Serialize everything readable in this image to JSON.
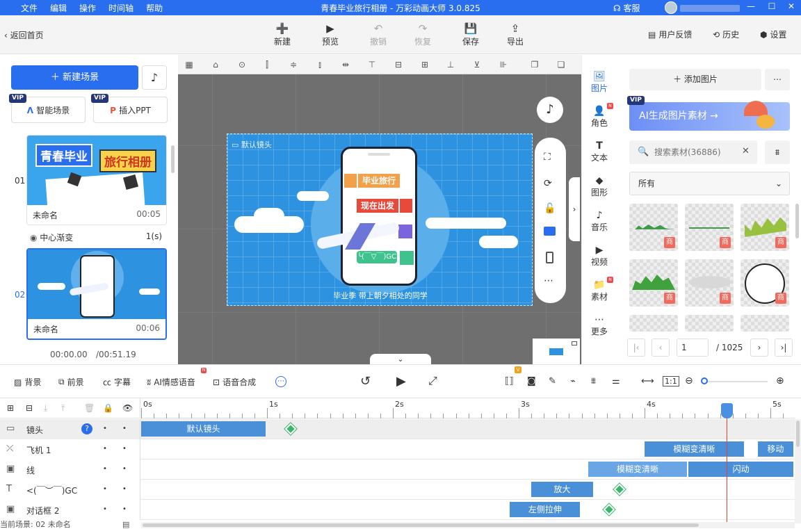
{
  "window": {
    "menu": [
      "文件",
      "编辑",
      "操作",
      "时间轴",
      "帮助"
    ],
    "title": "青春毕业旅行相册 - 万彩动画大师 3.0.825",
    "support": "客服",
    "controls": [
      "—",
      "☐",
      "✕"
    ]
  },
  "toolbar": {
    "back": "返回首页",
    "items": [
      {
        "label": "新建",
        "icon": "➕",
        "enabled": true
      },
      {
        "label": "预览",
        "icon": "▶",
        "enabled": true
      },
      {
        "label": "撤销",
        "icon": "↶",
        "enabled": false
      },
      {
        "label": "恢复",
        "icon": "↷",
        "enabled": false
      },
      {
        "label": "保存",
        "icon": "💾",
        "enabled": true
      },
      {
        "label": "导出",
        "icon": "⇪",
        "enabled": true
      }
    ],
    "feedback": "用户反馈",
    "history": "历史",
    "settings": "设置"
  },
  "left": {
    "new_scene": "新建场景",
    "vip_badge": "VIP",
    "smart_scene": "智能场景",
    "insert_ppt": "插入PPT",
    "scenes": [
      {
        "index": "01",
        "name": "未命名",
        "duration": "00:05",
        "banner_left": "青春毕业",
        "banner_right": "旅行相册"
      },
      {
        "index": "02",
        "name": "未命名",
        "duration": "00:06"
      }
    ],
    "transition": {
      "name": "中心渐变",
      "duration": "1(s)"
    },
    "time_current": "00:00.00",
    "time_total": "/00:51.19"
  },
  "stage": {
    "camera_label": "默认镜头",
    "badges": [
      "毕业旅行",
      "现在出发"
    ],
    "emoticon": "╰(￣▽￣)GC",
    "caption": "毕业季 带上朝夕相处的同学"
  },
  "right_nav": [
    {
      "label": "图片",
      "icon": "🖼",
      "active": true,
      "new": false
    },
    {
      "label": "角色",
      "icon": "👤",
      "active": false,
      "new": true
    },
    {
      "label": "文本",
      "icon": "T",
      "active": false,
      "new": false
    },
    {
      "label": "图形",
      "icon": "◆",
      "active": false,
      "new": false
    },
    {
      "label": "音乐",
      "icon": "♪",
      "active": false,
      "new": false
    },
    {
      "label": "视频",
      "icon": "▶",
      "active": false,
      "new": false
    },
    {
      "label": "素材",
      "icon": "📁",
      "active": false,
      "new": true
    },
    {
      "label": "更多",
      "icon": "⋯",
      "active": false,
      "new": false
    }
  ],
  "new_badge": "N",
  "right": {
    "add_image": "添加图片",
    "ai_banner": "AI生成图片素材",
    "search_placeholder": "搜索素材(36886)",
    "filter_value": "所有",
    "badge": "商",
    "page_current": "1",
    "page_total": "/ 1025"
  },
  "bottombar": {
    "tools": [
      "背景",
      "前景",
      "字幕",
      "AI情感语音",
      "语音合成"
    ]
  },
  "timeline": {
    "ticks": [
      "0s",
      "1s",
      "2s",
      "3s",
      "4s",
      "5s"
    ],
    "status": "当前场景: 02   未命名",
    "tracks": [
      {
        "name": "镜头",
        "clips": [
          {
            "label": "默认镜头",
            "start": 0,
            "end": 1.0,
            "light": false
          }
        ],
        "diamonds": [
          1.19
        ]
      },
      {
        "name": "飞机 1",
        "clips": [
          {
            "label": "模糊变清晰",
            "start": 4.0,
            "end": 4.8,
            "light": false
          },
          {
            "label": "移动",
            "start": 4.9,
            "end": 5.2,
            "light": false
          }
        ],
        "diamonds": []
      },
      {
        "name": "线",
        "clips": [
          {
            "label": "模糊变清晰",
            "start": 3.55,
            "end": 4.35,
            "light": true
          },
          {
            "label": "闪动",
            "start": 4.35,
            "end": 5.2,
            "light": false
          }
        ],
        "diamonds": []
      },
      {
        "name": "<(￣︶￣)GC",
        "clips": [
          {
            "label": "放大",
            "start": 3.1,
            "end": 3.6,
            "light": false
          }
        ],
        "diamonds": [
          3.8
        ]
      },
      {
        "name": "对话框 2",
        "clips": [
          {
            "label": "左侧拉伸",
            "start": 2.93,
            "end": 3.5,
            "light": false
          }
        ],
        "diamonds": [
          3.72
        ]
      }
    ],
    "playhead": 4.65
  },
  "colors": {
    "accent": "#2a6ef0",
    "clip": "#4a90d9",
    "clip_light": "#6aa6e6",
    "vip": "#25357a",
    "badge": "#f36a5a"
  }
}
